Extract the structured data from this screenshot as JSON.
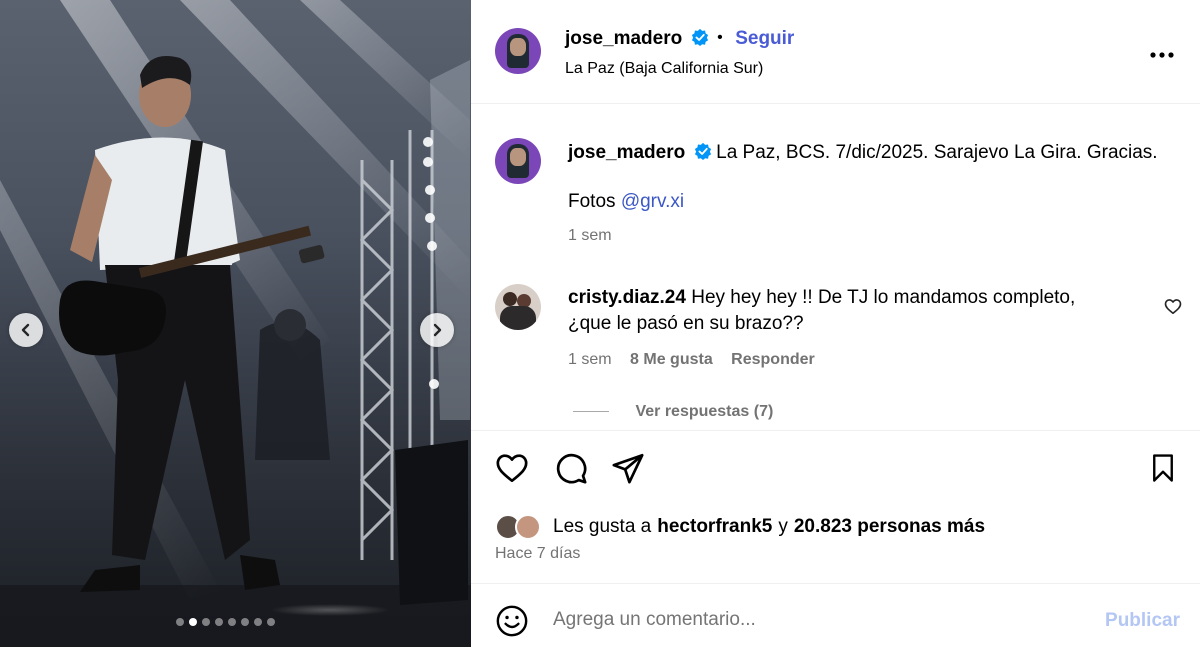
{
  "post": {
    "username": "jose_madero",
    "follow_separator": "•",
    "follow_label": "Seguir",
    "location": "La Paz (Baja California Sur)",
    "more_label": "•••"
  },
  "caption": {
    "username": "jose_madero",
    "text": "La Paz, BCS. 7/dic/2025. Sarajevo La Gira. Gracias.",
    "photos_prefix": "Fotos",
    "mention": "@grv.xi",
    "time": "1 sem"
  },
  "comment": {
    "username": "cristy.diaz.24",
    "text_line1": "Hey hey hey !! De TJ lo mandamos completo,",
    "text_line2": "¿que le pasó en su brazo??",
    "time": "1 sem",
    "likes": "8 Me gusta",
    "reply_label": "Responder",
    "view_replies": "Ver respuestas (7)"
  },
  "likes": {
    "prefix": "Les gusta a",
    "user": "hectorfrank5",
    "connector": "y",
    "count_text": "20.823 personas más"
  },
  "date": "Hace 7 días",
  "comment_box": {
    "placeholder": "Agrega un comentario...",
    "publish_label": "Publicar"
  },
  "carousel": {
    "total": 8,
    "active": 2
  },
  "icons": {
    "like": "heart-icon",
    "comment": "comment-icon",
    "share": "share-icon",
    "save": "bookmark-icon",
    "emoji": "emoji-icon",
    "prev": "chevron-left-icon",
    "next": "chevron-right-icon",
    "more": "more-options-icon",
    "verified": "verified-badge-icon"
  },
  "colors": {
    "follow": "#4a5bd6",
    "mention": "#3b57c6",
    "publish_disabled": "#b3c6f4",
    "muted": "#737373",
    "avatar_bg": "#7b46b8",
    "verified": "#0095f6"
  }
}
